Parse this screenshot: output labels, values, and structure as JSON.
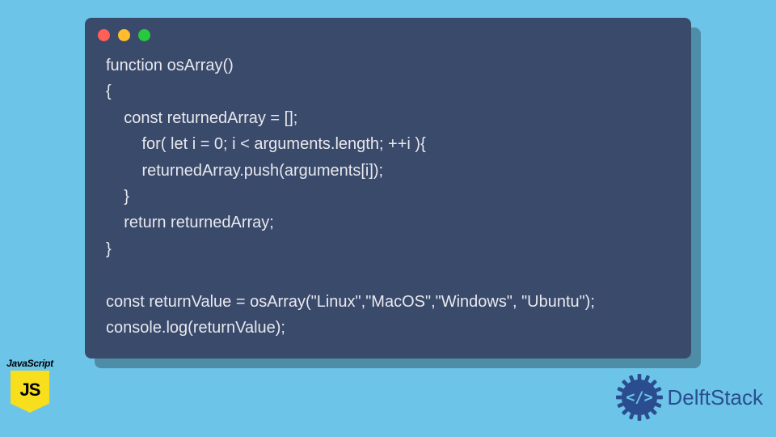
{
  "window": {
    "dots": [
      "red",
      "yellow",
      "green"
    ]
  },
  "code": {
    "lines": [
      "function osArray()",
      "{",
      "    const returnedArray = [];",
      "        for( let i = 0; i < arguments.length; ++i ){",
      "        returnedArray.push(arguments[i]);",
      "    }",
      "    return returnedArray;",
      "}",
      "",
      "const returnValue = osArray(\"Linux\",\"MacOS\",\"Windows\", \"Ubuntu\");",
      "console.log(returnValue);"
    ]
  },
  "badge": {
    "label": "JavaScript",
    "shield_text": "JS"
  },
  "brand": {
    "name": "DelftStack"
  },
  "colors": {
    "page_bg": "#6cc4e8",
    "window_bg": "#3a4a6b",
    "js_yellow": "#f7df1e",
    "brand_blue": "#2a4d8f"
  }
}
